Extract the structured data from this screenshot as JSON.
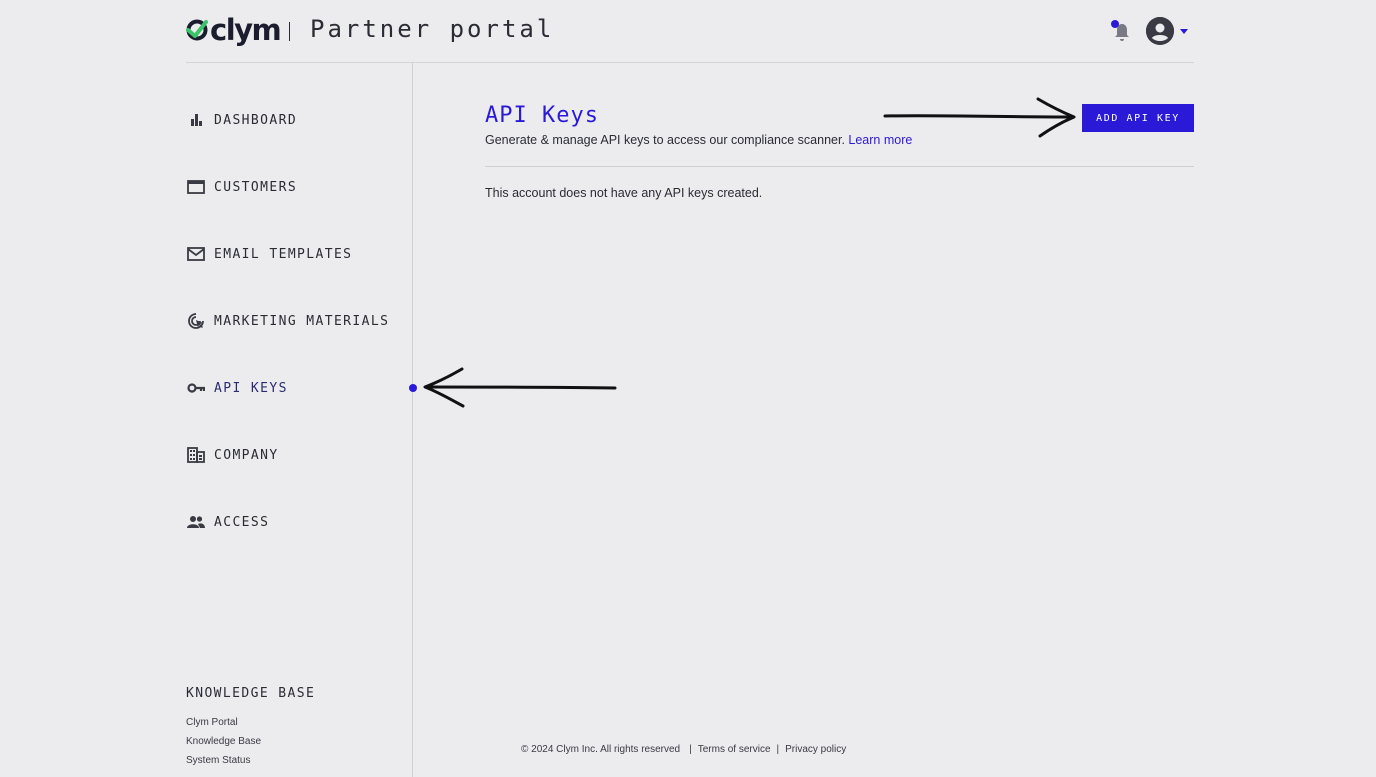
{
  "header": {
    "logo_text": "clym",
    "portal_title": "Partner portal",
    "notification_icon": "bell-icon",
    "avatar_icon": "account-circle-icon",
    "menu_icon": "caret-down-icon"
  },
  "sidebar": {
    "items": [
      {
        "label": "DASHBOARD",
        "icon": "bar-chart-icon"
      },
      {
        "label": "CUSTOMERS",
        "icon": "folder-window-icon"
      },
      {
        "label": "EMAIL TEMPLATES",
        "icon": "mail-icon"
      },
      {
        "label": "MARKETING MATERIALS",
        "icon": "cursor-click-icon"
      },
      {
        "label": "API KEYS",
        "icon": "key-icon",
        "active": true
      },
      {
        "label": "COMPANY",
        "icon": "building-icon"
      },
      {
        "label": "ACCESS",
        "icon": "people-icon"
      }
    ],
    "knowledge_base": {
      "title": "KNOWLEDGE BASE",
      "links": [
        "Clym Portal",
        "Knowledge Base",
        "System Status"
      ]
    }
  },
  "main": {
    "title": "API Keys",
    "subtitle": "Generate & manage API keys to access our compliance scanner.",
    "learn_more": "Learn more",
    "add_button": "ADD API KEY",
    "empty_message": "This account does not have any API keys created."
  },
  "footer": {
    "copyright": "© 2024 Clym Inc. All rights reserved",
    "separator": "|",
    "terms": "Terms of service",
    "privacy": "Privacy policy"
  },
  "colors": {
    "accent": "#2a1ad8",
    "background": "#ececee",
    "text": "#2b2b35"
  }
}
